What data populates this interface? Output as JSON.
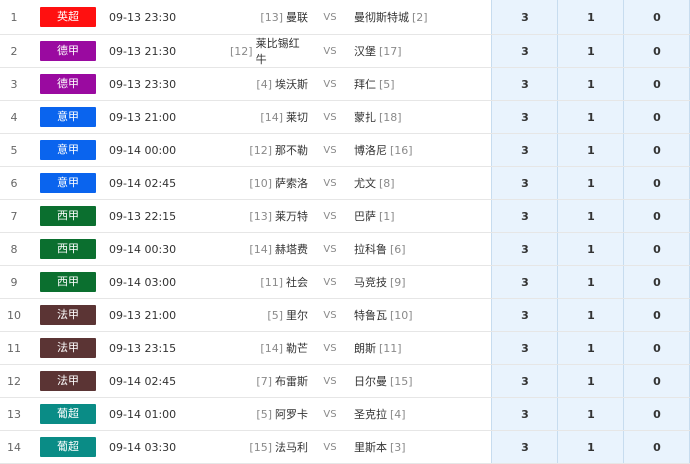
{
  "colors": {
    "英超": "#ff1010",
    "德甲": "#9a0aa0",
    "意甲": "#0a64ee",
    "西甲": "#0b6f2f",
    "法甲": "#5b3434",
    "葡超": "#0a8c86"
  },
  "rows": [
    {
      "idx": "1",
      "league": "英超",
      "time": "09-13 23:30",
      "home_rank": "[13]",
      "home": "曼联",
      "vs": "VS",
      "away": "曼彻斯特城",
      "away_rank": "[2]",
      "s1": "3",
      "s2": "1",
      "s3": "0"
    },
    {
      "idx": "2",
      "league": "德甲",
      "time": "09-13 21:30",
      "home_rank": "[12]",
      "home": "莱比锡红牛",
      "vs": "VS",
      "away": "汉堡",
      "away_rank": "[17]",
      "s1": "3",
      "s2": "1",
      "s3": "0"
    },
    {
      "idx": "3",
      "league": "德甲",
      "time": "09-13 23:30",
      "home_rank": "[4]",
      "home": "埃沃斯",
      "vs": "VS",
      "away": "拜仁",
      "away_rank": "[5]",
      "s1": "3",
      "s2": "1",
      "s3": "0"
    },
    {
      "idx": "4",
      "league": "意甲",
      "time": "09-13 21:00",
      "home_rank": "[14]",
      "home": "莱切",
      "vs": "VS",
      "away": "蒙扎",
      "away_rank": "[18]",
      "s1": "3",
      "s2": "1",
      "s3": "0"
    },
    {
      "idx": "5",
      "league": "意甲",
      "time": "09-14 00:00",
      "home_rank": "[12]",
      "home": "那不勒",
      "vs": "VS",
      "away": "博洛尼",
      "away_rank": "[16]",
      "s1": "3",
      "s2": "1",
      "s3": "0"
    },
    {
      "idx": "6",
      "league": "意甲",
      "time": "09-14 02:45",
      "home_rank": "[10]",
      "home": "萨索洛",
      "vs": "VS",
      "away": "尤文",
      "away_rank": "[8]",
      "s1": "3",
      "s2": "1",
      "s3": "0"
    },
    {
      "idx": "7",
      "league": "西甲",
      "time": "09-13 22:15",
      "home_rank": "[13]",
      "home": "莱万特",
      "vs": "VS",
      "away": "巴萨",
      "away_rank": "[1]",
      "s1": "3",
      "s2": "1",
      "s3": "0"
    },
    {
      "idx": "8",
      "league": "西甲",
      "time": "09-14 00:30",
      "home_rank": "[14]",
      "home": "赫塔费",
      "vs": "VS",
      "away": "拉科鲁",
      "away_rank": "[6]",
      "s1": "3",
      "s2": "1",
      "s3": "0"
    },
    {
      "idx": "9",
      "league": "西甲",
      "time": "09-14 03:00",
      "home_rank": "[11]",
      "home": "社会",
      "vs": "VS",
      "away": "马竞技",
      "away_rank": "[9]",
      "s1": "3",
      "s2": "1",
      "s3": "0"
    },
    {
      "idx": "10",
      "league": "法甲",
      "time": "09-13 21:00",
      "home_rank": "[5]",
      "home": "里尔",
      "vs": "VS",
      "away": "特鲁瓦",
      "away_rank": "[10]",
      "s1": "3",
      "s2": "1",
      "s3": "0"
    },
    {
      "idx": "11",
      "league": "法甲",
      "time": "09-13 23:15",
      "home_rank": "[14]",
      "home": "勒芒",
      "vs": "VS",
      "away": "朗斯",
      "away_rank": "[11]",
      "s1": "3",
      "s2": "1",
      "s3": "0"
    },
    {
      "idx": "12",
      "league": "法甲",
      "time": "09-14 02:45",
      "home_rank": "[7]",
      "home": "布雷斯",
      "vs": "VS",
      "away": "日尔曼",
      "away_rank": "[15]",
      "s1": "3",
      "s2": "1",
      "s3": "0"
    },
    {
      "idx": "13",
      "league": "葡超",
      "time": "09-14 01:00",
      "home_rank": "[5]",
      "home": "阿罗卡",
      "vs": "VS",
      "away": "圣克拉",
      "away_rank": "[4]",
      "s1": "3",
      "s2": "1",
      "s3": "0"
    },
    {
      "idx": "14",
      "league": "葡超",
      "time": "09-14 03:30",
      "home_rank": "[15]",
      "home": "法马利",
      "vs": "VS",
      "away": "里斯本",
      "away_rank": "[3]",
      "s1": "3",
      "s2": "1",
      "s3": "0"
    }
  ]
}
